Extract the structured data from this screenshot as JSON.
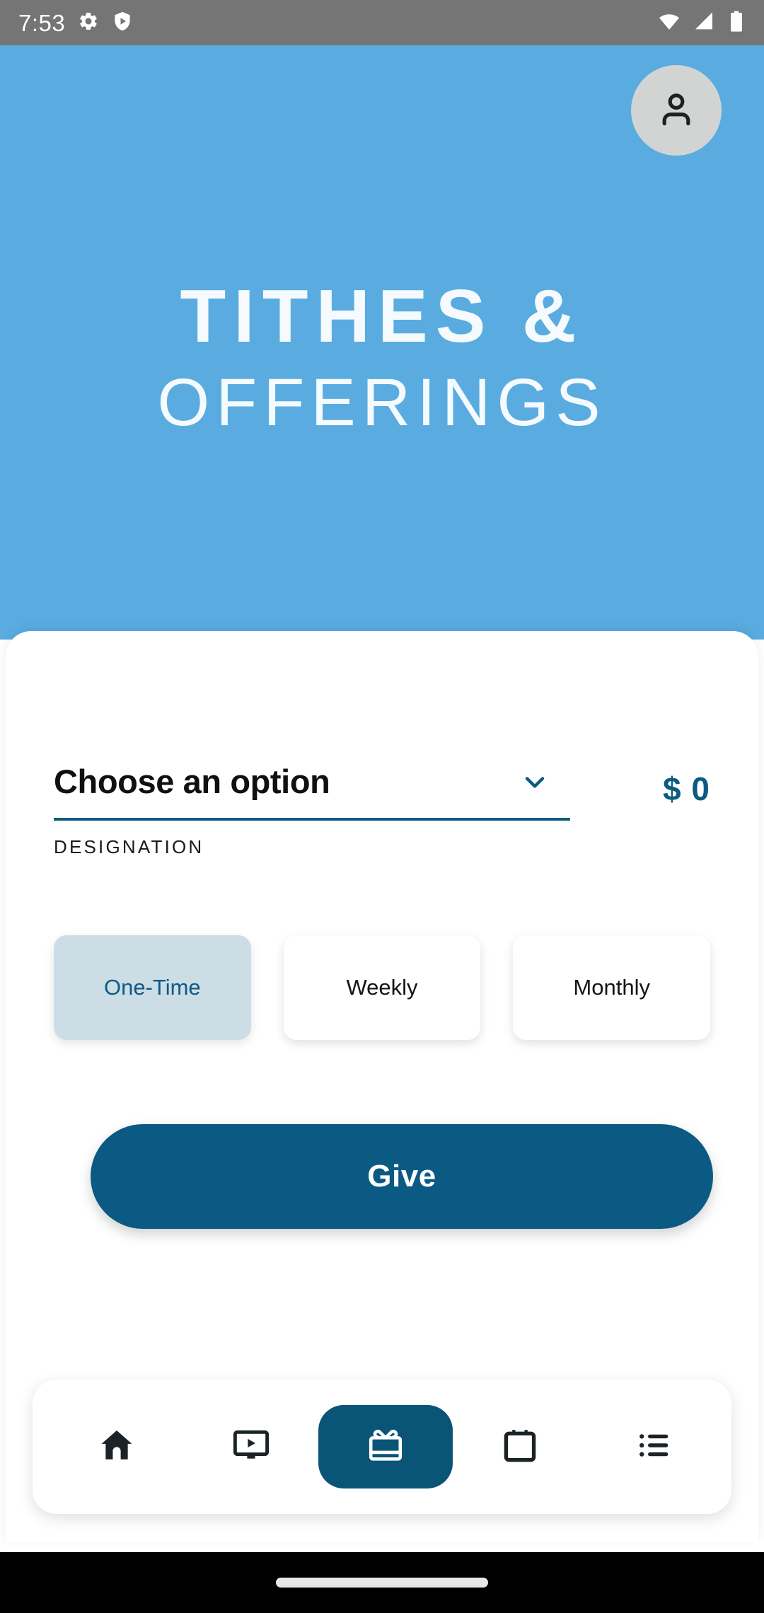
{
  "status_bar": {
    "time": "7:53",
    "left_icons": [
      "gear-icon",
      "play-protect-icon"
    ],
    "right_icons": [
      "wifi-icon",
      "cellular-signal-icon",
      "battery-icon"
    ],
    "background_color": "#757575"
  },
  "header": {
    "background_color": "#5aace0",
    "title_line1": "TITHES &",
    "title_line2": "OFFERINGS",
    "avatar": {
      "icon": "person-icon",
      "background_color": "#d2d4d4"
    }
  },
  "form": {
    "designation": {
      "selected_value": "Choose an option",
      "label": "DESIGNATION",
      "dropdown_icon": "chevron-down-icon",
      "underline_color": "#0d5a82"
    },
    "amount": {
      "currency_symbol": "$",
      "value": "0",
      "display": "$ 0",
      "color": "#0d5a82"
    },
    "frequency": {
      "options": [
        {
          "label": "One-Time",
          "selected": true
        },
        {
          "label": "Weekly",
          "selected": false
        },
        {
          "label": "Monthly",
          "selected": false
        }
      ],
      "selected_background": "#ccdde6",
      "selected_text_color": "#0d5a82"
    },
    "submit": {
      "label": "Give",
      "background_color": "#0a5a83",
      "text_color": "#ffffff"
    }
  },
  "bottom_nav": {
    "background_color": "#ffffff",
    "active_background": "#0a5478",
    "items": [
      {
        "icon": "home-icon",
        "active": false
      },
      {
        "icon": "media-player-icon",
        "active": false
      },
      {
        "icon": "gift-icon",
        "active": true
      },
      {
        "icon": "calendar-icon",
        "active": false
      },
      {
        "icon": "list-icon",
        "active": false
      }
    ]
  },
  "gesture_bar": {
    "background_color": "#000000",
    "handle_color": "#e8e8e8"
  }
}
